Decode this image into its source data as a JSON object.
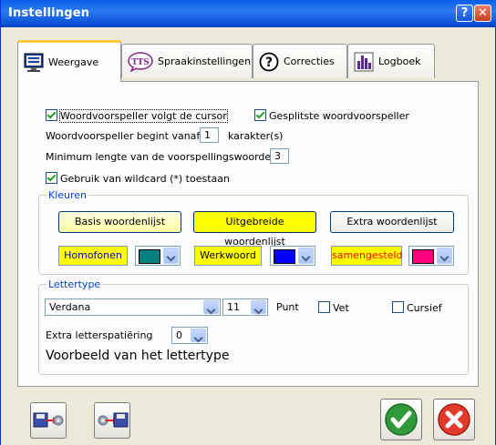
{
  "window": {
    "title": "Instellingen",
    "help_label": "?",
    "close_label": "✕"
  },
  "tabs": [
    {
      "label": "Weergave",
      "icon": "monitor-icon",
      "active": true
    },
    {
      "label": "Spraakinstellingen",
      "icon": "tts-icon",
      "icon_text": "TTS"
    },
    {
      "label": "Correcties",
      "icon": "question-icon",
      "icon_text": "?"
    },
    {
      "label": "Logboek",
      "icon": "bar-chart-icon"
    }
  ],
  "options": {
    "follow_cursor": {
      "label": "Woordvoorspeller volgt de cursor",
      "checked": true
    },
    "split_predictor": {
      "label": "Gesplitste woordvoorspeller",
      "checked": true
    },
    "start_from_label": "Woordvoorspeller begint vanaf",
    "start_from_value": "1",
    "start_from_unit": "karakter(s)",
    "min_length_label": "Minimum lengte van de voorspellingswoorden :",
    "min_length_value": "3",
    "wildcard": {
      "label": "Gebruik van wildcard (*) toestaan",
      "checked": true
    }
  },
  "colors": {
    "group_label": "Kleuren",
    "basis_button": "Basis woordenlijst",
    "uitgebreide_button": "Uitgebreide woordenlijst",
    "extra_button": "Extra woordenlijst",
    "homofonen_label": "Homofonen",
    "homofonen_color": "#008080",
    "werkwoord_label": "Werkwoord",
    "werkwoord_color": "#0000ff",
    "samengesteld_label": "samengesteld",
    "samengesteld_color": "#ff0080"
  },
  "font": {
    "group_label": "Lettertype",
    "family": "Verdana",
    "size": "11",
    "size_unit": "Punt",
    "bold_label": "Vet",
    "bold_checked": false,
    "italic_label": "Cursief",
    "italic_checked": false,
    "spacing_label": "Extra letterspatiëring",
    "spacing_value": "0",
    "preview_text": "Voorbeeld van het lettertype"
  },
  "footer": {
    "save_icon": "save-settings-icon",
    "load_icon": "load-settings-icon",
    "ok_icon": "ok-check-icon",
    "cancel_icon": "cancel-x-icon"
  }
}
